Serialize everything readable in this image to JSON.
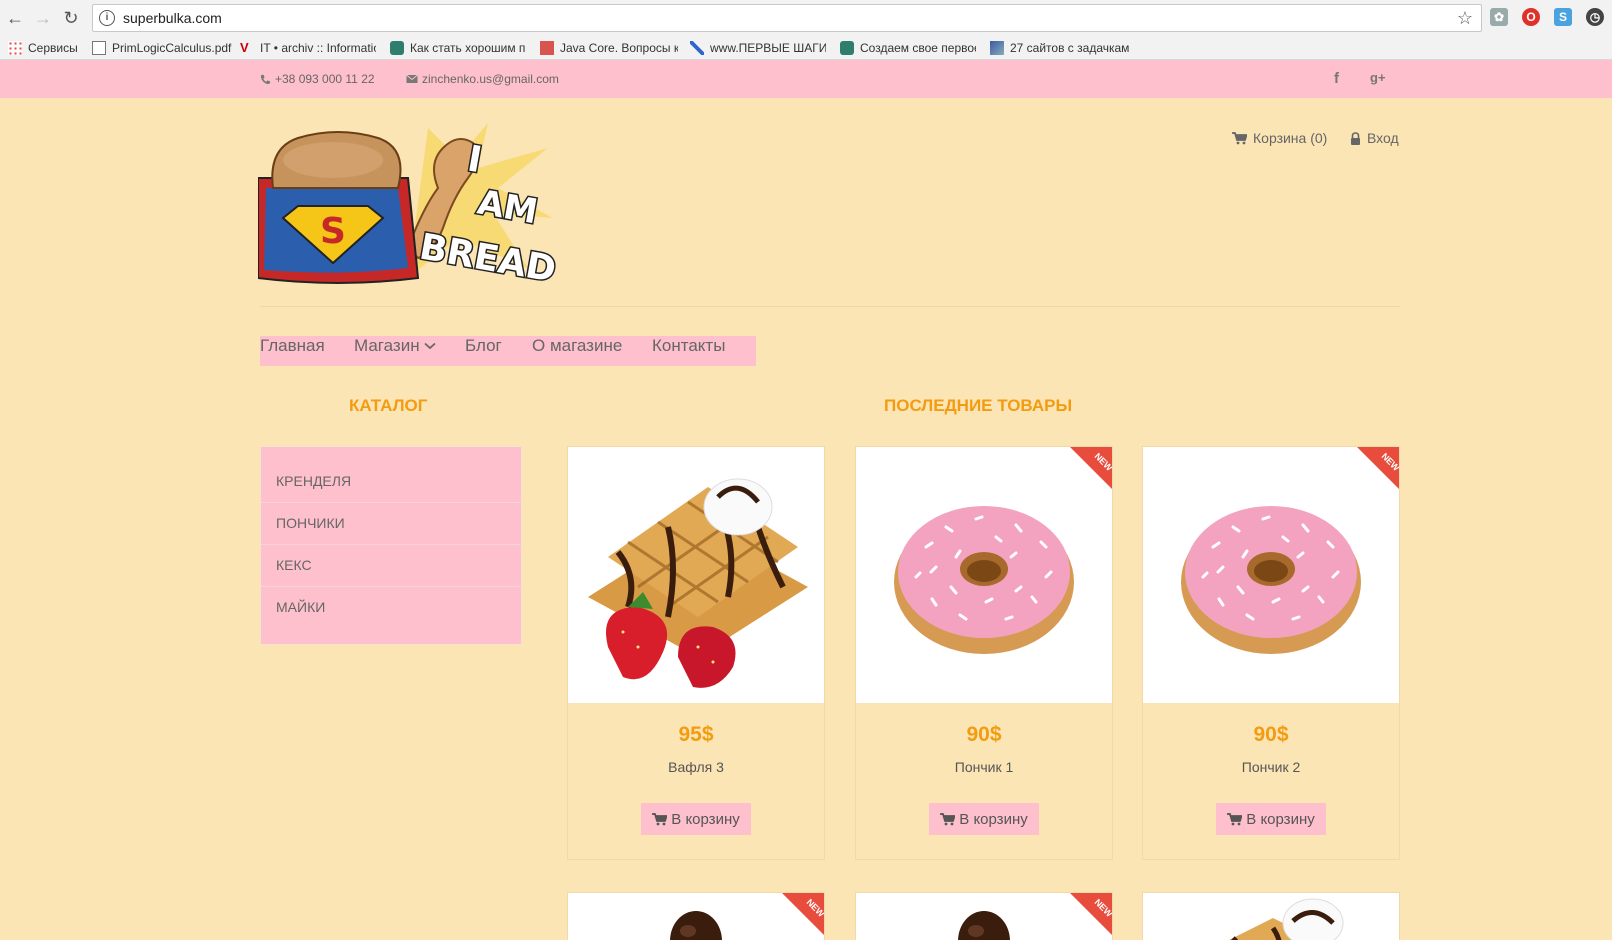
{
  "browser": {
    "url": "superbulka.com",
    "bookmarks": [
      {
        "label": "Сервисы"
      },
      {
        "label": "PrimLogicCalculus.pdf"
      },
      {
        "label": "IT • archiv :: Informatio"
      },
      {
        "label": "Как стать хорошим п"
      },
      {
        "label": "Java Core. Вопросы к"
      },
      {
        "label": "www.ПЕРВЫЕ ШАГИ.r"
      },
      {
        "label": "Создаем свое первое"
      },
      {
        "label": "27 сайтов с задачкам"
      }
    ]
  },
  "topbar": {
    "phone": "+38 093 000 11 22",
    "email": "zinchenko.us@gmail.com",
    "social": [
      "f",
      "g+"
    ]
  },
  "header": {
    "logo_text": "I AM BREAD",
    "cart": "Корзина (0)",
    "login": "Вход"
  },
  "nav": {
    "items": [
      {
        "label": "Главная"
      },
      {
        "label": "Магазин"
      },
      {
        "label": "Блог"
      },
      {
        "label": "О магазине"
      },
      {
        "label": "Контакты"
      }
    ]
  },
  "catalog": {
    "title": "КАТАЛОГ",
    "items": [
      {
        "label": "КРЕНДЕЛЯ"
      },
      {
        "label": "ПОНЧИКИ"
      },
      {
        "label": "КЕКС"
      },
      {
        "label": "МАЙКИ"
      }
    ]
  },
  "products": {
    "title": "ПОСЛЕДНИЕ ТОВАРЫ",
    "cart_button": "В корзину",
    "badge": "NEW",
    "items": [
      {
        "price": "95$",
        "name": "Вафля 3",
        "image": "waffle",
        "is_new": false
      },
      {
        "price": "90$",
        "name": "Пончик 1",
        "image": "donut",
        "is_new": true
      },
      {
        "price": "90$",
        "name": "Пончик 2",
        "image": "donut",
        "is_new": true
      }
    ],
    "second_row": [
      {
        "image": "chocolate",
        "is_new": true
      },
      {
        "image": "chocolate",
        "is_new": true
      },
      {
        "image": "waffle",
        "is_new": false
      }
    ]
  }
}
